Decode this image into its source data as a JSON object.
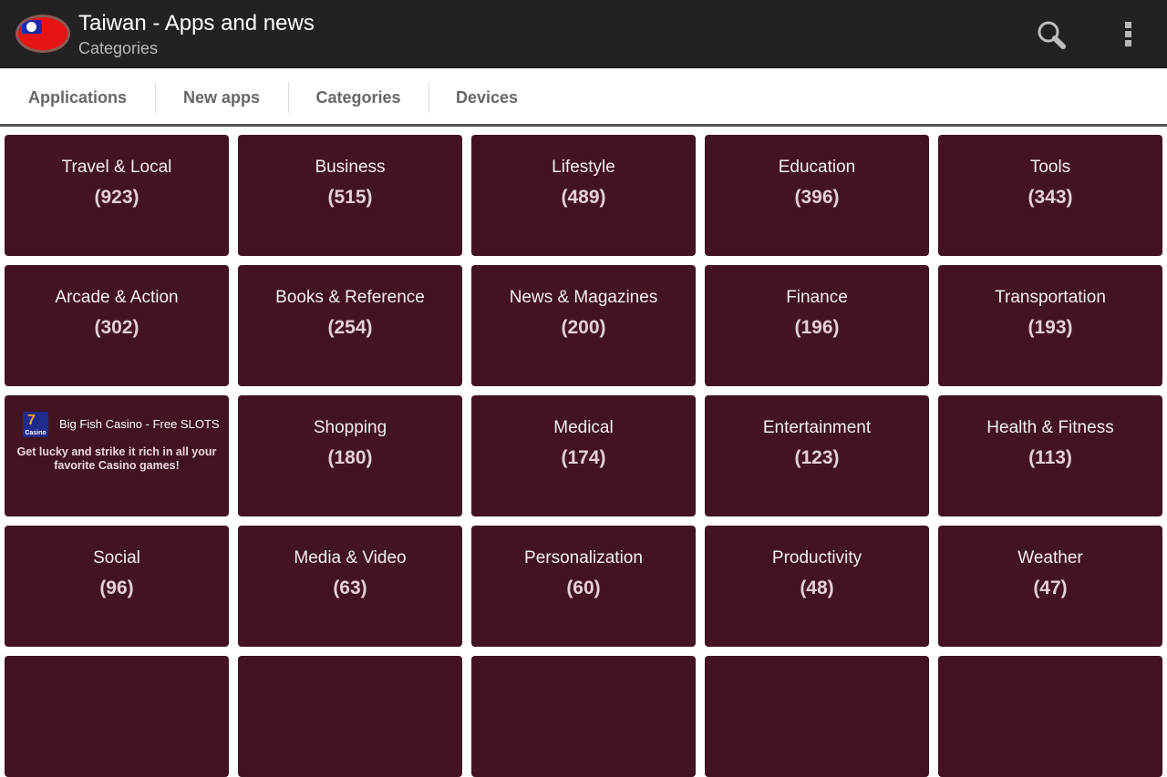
{
  "appbar": {
    "title": "Taiwan - Apps and news",
    "subtitle": "Categories",
    "logo_icon": "taiwan-flag-icon",
    "actions": [
      {
        "name": "search",
        "icon": "search-icon"
      },
      {
        "name": "overflow-menu",
        "icon": "more-vert-icon"
      }
    ]
  },
  "tabs": [
    {
      "label": "Applications"
    },
    {
      "label": "New apps"
    },
    {
      "label": "Categories",
      "selected": true
    },
    {
      "label": "Devices"
    }
  ],
  "colors": {
    "appbar_bg": "#222222",
    "tile_bg": "#421422",
    "tab_text": "#666666",
    "page_bg": "#ffffff"
  },
  "ad": {
    "icon": "big-fish-casino-icon",
    "icon_label": "Casino",
    "title": "Big Fish Casino - Free SLOTS",
    "description": "Get lucky and strike it rich in all your favorite Casino games!"
  },
  "categories": [
    {
      "name": "Travel & Local",
      "count": "(923)"
    },
    {
      "name": "Business",
      "count": "(515)"
    },
    {
      "name": "Lifestyle",
      "count": "(489)"
    },
    {
      "name": "Education",
      "count": "(396)"
    },
    {
      "name": "Tools",
      "count": "(343)"
    },
    {
      "name": "Arcade & Action",
      "count": "(302)"
    },
    {
      "name": "Books & Reference",
      "count": "(254)"
    },
    {
      "name": "News & Magazines",
      "count": "(200)"
    },
    {
      "name": "Finance",
      "count": "(196)"
    },
    {
      "name": "Transportation",
      "count": "(193)"
    },
    {
      "name": "Shopping",
      "count": "(180)"
    },
    {
      "name": "Medical",
      "count": "(174)"
    },
    {
      "name": "Entertainment",
      "count": "(123)"
    },
    {
      "name": "Health & Fitness",
      "count": "(113)"
    },
    {
      "name": "Social",
      "count": "(96)"
    },
    {
      "name": "Media & Video",
      "count": "(63)"
    },
    {
      "name": "Personalization",
      "count": "(60)"
    },
    {
      "name": "Productivity",
      "count": "(48)"
    },
    {
      "name": "Weather",
      "count": "(47)"
    }
  ]
}
